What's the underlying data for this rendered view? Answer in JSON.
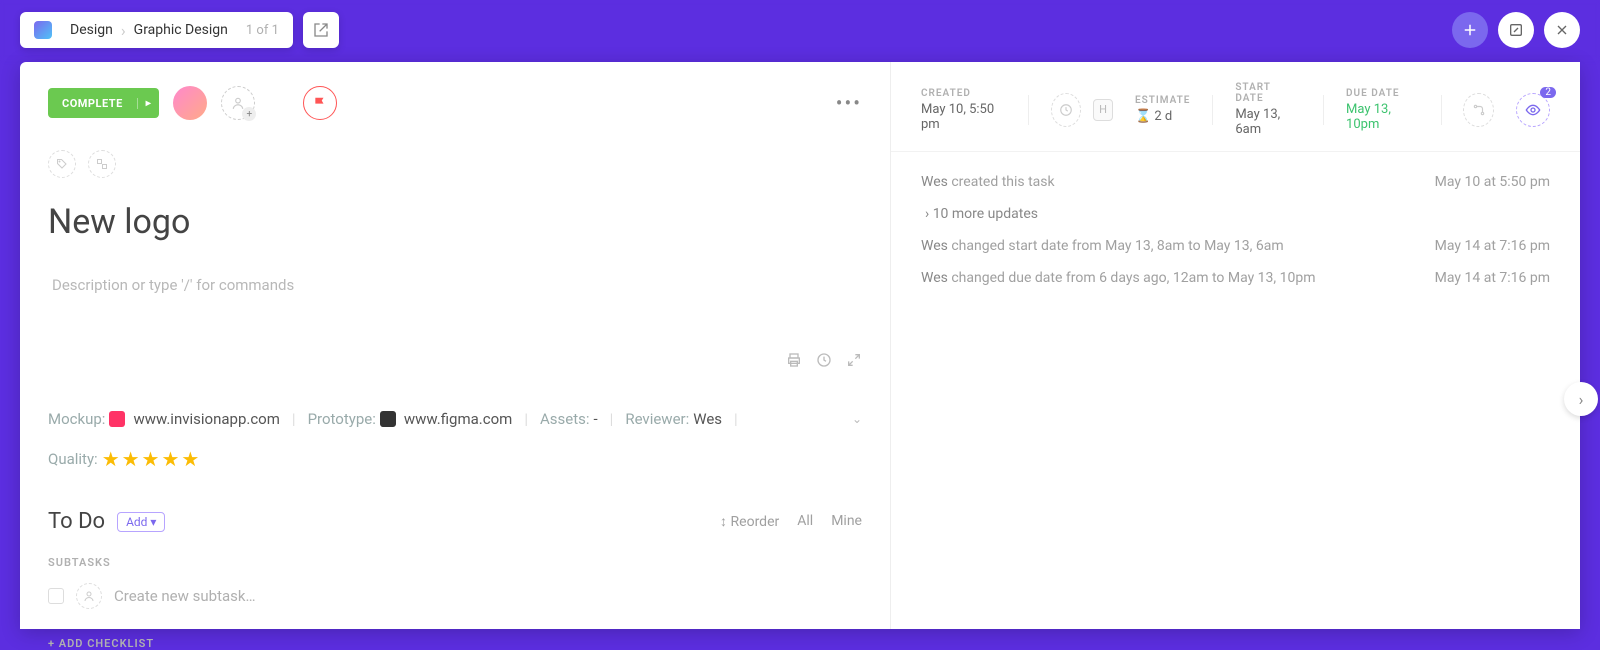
{
  "breadcrumb": {
    "root": "Design",
    "current": "Graphic Design",
    "position": "1 of 1"
  },
  "task": {
    "complete_label": "COMPLETE",
    "title": "New logo",
    "description_placeholder": "Description or type '/' for commands"
  },
  "fields": {
    "mockup_label": "Mockup:",
    "mockup_value": "www.invisionapp.com",
    "prototype_label": "Prototype:",
    "prototype_value": "www.figma.com",
    "assets_label": "Assets:",
    "assets_value": "-",
    "reviewer_label": "Reviewer:",
    "reviewer_value": "Wes",
    "quality_label": "Quality:",
    "quality_stars": "★★★★★"
  },
  "todo": {
    "title": "To Do",
    "add_label": "Add",
    "reorder": "Reorder",
    "all": "All",
    "mine": "Mine",
    "subtasks_label": "SUBTASKS",
    "new_subtask_placeholder": "Create new subtask…",
    "add_checklist": "+ ADD CHECKLIST"
  },
  "meta": {
    "created_label": "CREATED",
    "created_value": "May 10, 5:50 pm",
    "estimate_label": "ESTIMATE",
    "estimate_value": "2 d",
    "start_label": "START DATE",
    "start_value": "May 13, 6am",
    "due_label": "DUE DATE",
    "due_value": "May 13, 10pm",
    "h_label": "H",
    "watch_count": "2"
  },
  "activity": {
    "more": "10 more updates",
    "rows": [
      {
        "who": "Wes",
        "text": "created this task",
        "time": "May 10 at 5:50 pm"
      },
      {
        "who": "Wes",
        "text": "changed start date from May 13, 8am to May 13, 6am",
        "time": "May 14 at 7:16 pm"
      },
      {
        "who": "Wes",
        "text": "changed due date from 6 days ago, 12am to May 13, 10pm",
        "time": "May 14 at 7:16 pm"
      }
    ]
  }
}
